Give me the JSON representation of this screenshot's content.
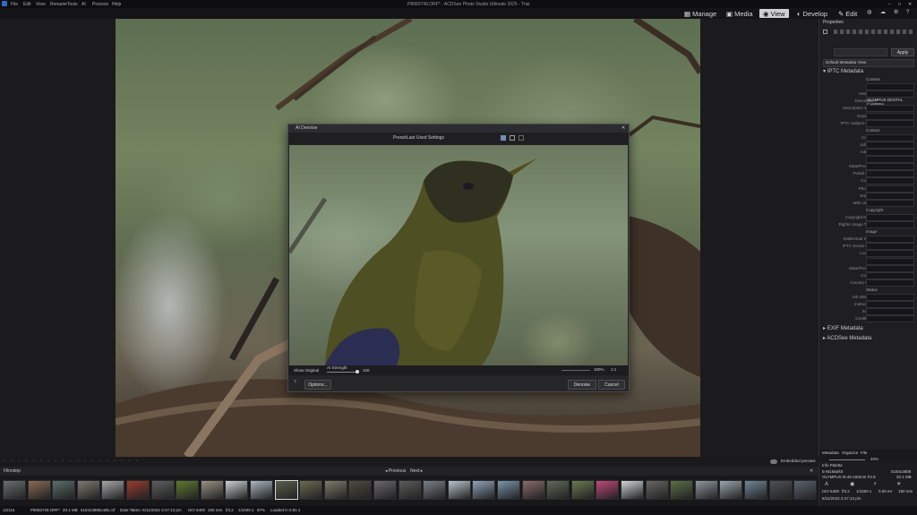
{
  "menubar": {
    "items": [
      "File",
      "Edit",
      "View",
      "Rename",
      "Tools",
      "AI",
      "Process",
      "Help"
    ],
    "window_title": "P8060749.ORF* - ACDSee Photo Studio Ultimate 2025 - Trial"
  },
  "modes": {
    "items": [
      {
        "label": "Manage",
        "icon": "grid-icon"
      },
      {
        "label": "Media",
        "icon": "media-icon"
      },
      {
        "label": "View",
        "icon": "eye-icon",
        "active": true
      },
      {
        "label": "Develop",
        "icon": "develop-icon"
      },
      {
        "label": "Edit",
        "icon": "edit-icon"
      }
    ]
  },
  "dialog": {
    "title": "AI Denoise",
    "preset_label": "Preset:",
    "preset_value": "Last Used Settings",
    "show_original_label": "Show Original",
    "strength_label": "AI Strength",
    "strength_value": "100",
    "zoom_value": "100%",
    "zoom_fit": "1:1",
    "options_label": "Options...",
    "denoise_label": "Denoise",
    "cancel_label": "Cancel"
  },
  "properties": {
    "title": "Properties",
    "metadata_view": "Default Metadata View",
    "apply_label": "Apply",
    "sections": {
      "iptc": "IPTC Metadata",
      "exif": "EXIF Metadata",
      "acdsee": "ACDSee Metadata"
    },
    "iptc_fields": [
      {
        "label": "Content",
        "value": "",
        "header": true
      },
      {
        "label": "Title",
        "value": ""
      },
      {
        "label": "Headline",
        "value": ""
      },
      {
        "label": "Description",
        "value": "OLYMPUS DIGITAL CAMERA"
      },
      {
        "label": "Description Writer",
        "value": ""
      },
      {
        "label": "Keywords",
        "value": ""
      },
      {
        "label": "IPTC Subject Code",
        "value": ""
      },
      {
        "label": "Contact",
        "value": "",
        "header": true
      },
      {
        "label": "Creator",
        "value": ""
      },
      {
        "label": "Job Title",
        "value": ""
      },
      {
        "label": "Address",
        "value": ""
      },
      {
        "label": "City",
        "value": ""
      },
      {
        "label": "State/Province",
        "value": ""
      },
      {
        "label": "Postal Code",
        "value": ""
      },
      {
        "label": "Country",
        "value": ""
      },
      {
        "label": "Phone(s)",
        "value": ""
      },
      {
        "label": "Email(s)",
        "value": ""
      },
      {
        "label": "Web URL(s)",
        "value": ""
      },
      {
        "label": "Copyright",
        "value": "",
        "header": true
      },
      {
        "label": "Copyright Notice",
        "value": ""
      },
      {
        "label": "Rights Usage Terms",
        "value": ""
      },
      {
        "label": "Image",
        "value": "",
        "header": true
      },
      {
        "label": "Intellectual Genre",
        "value": ""
      },
      {
        "label": "IPTC Scene Code",
        "value": ""
      },
      {
        "label": "Location",
        "value": ""
      },
      {
        "label": "City",
        "value": ""
      },
      {
        "label": "State/Province",
        "value": ""
      },
      {
        "label": "Country",
        "value": ""
      },
      {
        "label": "Country Code",
        "value": ""
      },
      {
        "label": "Status",
        "value": "",
        "header": true
      },
      {
        "label": "Job Identifier",
        "value": ""
      },
      {
        "label": "Instructions",
        "value": ""
      },
      {
        "label": "Source",
        "value": ""
      },
      {
        "label": "Credit Line",
        "value": ""
      }
    ],
    "tabs": [
      "Metadata",
      "Organize",
      "File"
    ],
    "embedded_preview": "Embedded preview",
    "zoom": "40%"
  },
  "filmstrip": {
    "title": "Filmstrip",
    "previous": "Previous",
    "next": "Next",
    "thumbs": [
      "#6a6e72",
      "#8a6b58",
      "#5b6e6a",
      "#7c7a70",
      "#a4a6a8",
      "#9a3b30",
      "#5d5f62",
      "#5f7a2e",
      "#9a9184",
      "#c9d0d4",
      "#aab6c2",
      "#5a5e4c",
      "#6c6a52",
      "#7e7a6a",
      "#4f4a40",
      "#6a6a6e",
      "#5c5d5a",
      "#7a8087",
      "#b8c4cc",
      "#8fa2b8",
      "#7a94ab",
      "#8a6a6a",
      "#5e6a58",
      "#6a7a52",
      "#c04a7a",
      "#cfd4d8",
      "#6a6660",
      "#5c7048",
      "#8d96a0",
      "#9aa5ae",
      "#6f8696",
      "#4e5056",
      "#5a6370",
      "#6e7480"
    ]
  },
  "info_palette": {
    "title": "Info Palette",
    "camera": "E-M1MarkII",
    "lens": "OLYMPUS M.40-150mm F2.8",
    "size": "5184x3888",
    "filesize": "20.1 MB",
    "iso": "ISO 6400",
    "aperture": "f/3.2",
    "shutter": "1/1600 s",
    "ev": "0.00 eV",
    "focal": "150 mm",
    "date": "6/11/2022 3:47:13 pm"
  },
  "status": {
    "index": "12/115",
    "filename": "P8060749.ORF*",
    "filesize": "20.1 MB",
    "dimensions": "5184x3888x48b.orf",
    "date_taken": "Date Taken: 6/11/2022 3:47:13 pm",
    "iso": "ISO 6400",
    "focal": "150 mm",
    "aperture": "f/3.2",
    "shutter": "1/1600 s",
    "zoom": "97%",
    "loaded": "Loaded in 0.81 s"
  },
  "colors": {
    "accent": "#4a90d9",
    "panel": "#1f1f22",
    "background": "#1b1b1d"
  }
}
